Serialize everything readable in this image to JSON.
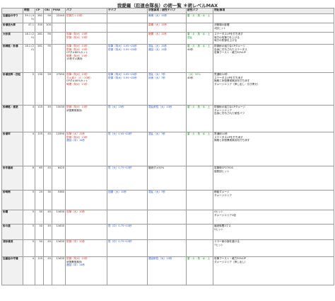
{
  "title": "我愛羅（忍連合隊長）の術一覧 ＊術レベルMAX",
  "headers": [
    "",
    "時間",
    "CP",
    "CRI",
    "POW",
    "バフ",
    "デバフ",
    "状態異常 / 耐性デバフ",
    "耐性バフ",
    "特記事項"
  ],
  "rows": [
    {
      "name": "加重岩の守り",
      "sub": "",
      "time": "39.1 (45)",
      "cp": "281",
      "cri": "90",
      "pow": "22240",
      "buff": [
        {
          "t": "防御力＋10秒",
          "c": "r"
        }
      ],
      "debuff": [],
      "status": [
        {
          "t": "麻痺（大）15秒",
          "c": "b"
        }
      ],
      "resbuff": [
        {
          "t": "雷・炎・風・水・土",
          "c": "g"
        }
      ],
      "notes": [
        {
          "t": "",
          "c": "k"
        }
      ]
    },
    {
      "name": "砂瀑送大葬",
      "sub": "",
      "time": "47.1",
      "cp": "330",
      "cri": "100",
      "pow": "",
      "buff": [],
      "debuff": [],
      "status": [
        {
          "t": "劇毒（大）15秒",
          "c": "r"
        }
      ],
      "resbuff": [],
      "notes": [
        {
          "t": "決戦場の影響",
          "c": "k"
        },
        {
          "t": "2回ヒット",
          "c": "k"
        }
      ]
    },
    {
      "name": "大砂漠",
      "sub": "",
      "time": "18.1 (20)",
      "cp": "281",
      "cri": "95",
      "pow": "",
      "buff": [
        {
          "t": "攻撃（特大）15秒",
          "c": "r"
        },
        {
          "t": "防御（特大）15秒",
          "c": "r"
        }
      ],
      "debuff": [],
      "status": [
        {
          "t": "暗闇（大）15秒",
          "c": "r"
        }
      ],
      "resbuff": [
        {
          "t": "雷・炎・風・水・土",
          "c": "g"
        },
        {
          "t": "混乱",
          "c": "g"
        }
      ],
      "notes": [
        {
          "t": "ステータスUPを打ち消す",
          "c": "k"
        },
        {
          "t": "味方の攻撃力を上げる",
          "c": "k"
        },
        {
          "t": "味方の防御を上げる",
          "c": "k"
        }
      ]
    },
    {
      "name": "砂縛柩・砂瀑",
      "sub": "",
      "time": "18.1 (20)",
      "cp": "281",
      "cri": "95",
      "pow": "",
      "buff": [
        {
          "t": "攻撃（特大）15秒",
          "c": "r"
        },
        {
          "t": "防御（特大）15秒",
          "c": "r"
        },
        {
          "t": "CPダメ80%カット",
          "c": "k"
        },
        {
          "t": "時間（特大）15秒",
          "c": "r"
        },
        {
          "t": "15秒ダメ無効",
          "c": "k"
        }
      ],
      "debuff": [
        {
          "t": "攻撃（特大）0.95→20秒",
          "c": "b"
        },
        {
          "t": "防御（特大）0.95→20秒",
          "c": "b"
        }
      ],
      "status": [
        {
          "t": "混乱（大）15秒",
          "c": "b"
        },
        {
          "t": "遅延（大）15秒",
          "c": "b"
        }
      ],
      "resbuff": [
        {
          "t": "雷・炎・風・水・土",
          "c": "g"
        },
        {
          "t": "40秒",
          "c": "k"
        }
      ],
      "notes": [
        {
          "t": "防御術の強力なCPダメージ",
          "c": "k"
        },
        {
          "t": "自身に付与されたステータス",
          "c": "k"
        },
        {
          "t": "攻撃ブースト・威力30%UP",
          "c": "k"
        }
      ]
    },
    {
      "name": "砂瀑送葬・四柱",
      "sub": "",
      "time": "5",
      "cp": "130",
      "cri": "59",
      "pow": "27550",
      "buff": [
        {
          "t": "攻撃（特大）15秒",
          "c": "r"
        },
        {
          "t": "ダメ減少（小・20秒）",
          "c": "r"
        },
        {
          "t": "CPダメ40%カット",
          "c": "k"
        },
        {
          "t": "時間（特大）15秒",
          "c": "r"
        }
      ],
      "debuff": [
        {
          "t": "攻撃（特大）0.95→20秒",
          "c": "b"
        },
        {
          "t": "防御（特大）0.95→20秒",
          "c": "b"
        }
      ],
      "status": [
        {
          "t": "混乱（大）7秒",
          "c": "b"
        },
        {
          "t": "封術（大）7秒",
          "c": "b"
        }
      ],
      "resbuff": [
        {
          "t": "（大）50%",
          "c": "g"
        },
        {
          "t": "40秒",
          "c": "k"
        }
      ],
      "notes": [
        {
          "t": "貫通術10秒",
          "c": "k"
        },
        {
          "t": "ステータスUPを打ち消す",
          "c": "k"
        },
        {
          "t": "無敵と状態異常無効を打ち消す",
          "c": "k"
        },
        {
          "t": "ダメージエリア（押し出し・引き寄せ）",
          "c": "k"
        }
      ]
    },
    {
      "name": "砂縛柩・連塗",
      "sub": "",
      "time": "4",
      "cp": "110",
      "cri": "45",
      "pow": "15030",
      "buff": [
        {
          "t": "防御（特大）15秒",
          "c": "r"
        },
        {
          "t": "状態異常無効",
          "c": "k"
        }
      ],
      "debuff": [
        {
          "t": "防（大）15秒",
          "c": "b"
        }
      ],
      "status": [
        {
          "t": "混乱耐性（大）15秒",
          "c": "b"
        }
      ],
      "resbuff": [
        {
          "t": "雷・炎・風・水・土",
          "c": "g"
        }
      ],
      "notes": [
        {
          "t": "防御術の強力なCPダメージ",
          "c": "k"
        },
        {
          "t": "ダメージエリア",
          "c": "k"
        },
        {
          "t": "自身に付与された耐性バフ",
          "c": "k"
        }
      ]
    },
    {
      "name": "砂瀑牢",
      "sub": "",
      "time": "4",
      "cp": "110",
      "cri": "45",
      "pow": "13390",
      "buff": [
        {
          "t": "攻撃（大）15秒",
          "c": "r"
        },
        {
          "t": "防御（特大）15秒",
          "c": "r"
        },
        {
          "t": "遅延（中）14秒",
          "c": "b"
        }
      ],
      "debuff": [
        {
          "t": "防（大）0.95→20秒",
          "c": "b"
        }
      ],
      "status": [
        {
          "t": "混乱（大）7秒",
          "c": "b"
        }
      ],
      "resbuff": [
        {
          "t": "雷・炎・風・水・土",
          "c": "g"
        }
      ],
      "notes": [
        {
          "t": "貫通術10秒",
          "c": "k"
        },
        {
          "t": "ステータスUPを打ち消す",
          "c": "k"
        },
        {
          "t": "無敵と状態異常無効を打ち消す",
          "c": "k"
        }
      ]
    },
    {
      "name": "砂手裏剣",
      "sub": "",
      "time": "6",
      "cp": "65",
      "cri": "45",
      "pow": "6420",
      "buff": [],
      "debuff": [
        {
          "t": "防（大）0.75→15秒",
          "c": "b"
        }
      ],
      "status": [
        {
          "t": "継続ダメ50%",
          "c": "k"
        }
      ],
      "resbuff": [],
      "notes": [
        {
          "t": "攻撃時CP27000",
          "c": "k"
        },
        {
          "t": "複数回ヒット",
          "c": "k"
        }
      ]
    },
    {
      "name": "砂時雨",
      "sub": "",
      "time": "5",
      "cp": "20",
      "cri": "30",
      "pow": "5380",
      "buff": [],
      "debuff": [
        {
          "t": "回避（大）15秒",
          "c": "b"
        }
      ],
      "status": [
        {
          "t": "混乱（大）7秒",
          "c": "b"
        }
      ],
      "resbuff": [],
      "notes": [
        {
          "t": "移動ダメージ",
          "c": "k"
        },
        {
          "t": "ダメージエリア",
          "c": "k"
        }
      ]
    },
    {
      "name": "砂霧",
      "sub": "",
      "time": "5",
      "cp": "30",
      "cri": "45",
      "pow": "11630",
      "buff": [
        {
          "t": "攻撃（大）10秒",
          "c": "r"
        }
      ],
      "debuff": [],
      "status": [],
      "resbuff": [],
      "notes": [
        {
          "t": "4ヒット",
          "c": "k"
        },
        {
          "t": "ダメージエリア2倍",
          "c": "k"
        }
      ]
    },
    {
      "name": "砂の盾",
      "sub": "",
      "time": "5",
      "cp": "30",
      "cri": "45",
      "pow": "11630",
      "buff": [],
      "debuff": [
        {
          "t": "防（中）0.75→10秒",
          "c": "b"
        }
      ],
      "status": [],
      "resbuff": [],
      "notes": [
        {
          "t": "継続時間3マス",
          "c": "k"
        },
        {
          "t": "5ヒット",
          "c": "k"
        }
      ]
    },
    {
      "name": "流砂瀑流",
      "sub": "",
      "time": "5",
      "cp": "30",
      "cri": "45",
      "pow": "11630",
      "buff": [
        {
          "t": "防御（中）10秒",
          "c": "r"
        }
      ],
      "debuff": [
        {
          "t": "防（中）0.75→15秒",
          "c": "b"
        }
      ],
      "status": [],
      "resbuff": [],
      "notes": [
        {
          "t": "ミラー術の崩を避ける",
          "c": "k"
        },
        {
          "t": "7ヒット",
          "c": "k"
        }
      ]
    },
    {
      "name": "加重岩の守護",
      "sub": "",
      "time": "4",
      "cp": "110",
      "cri": "45",
      "pow": "11630",
      "buff": [
        {
          "t": "防御（特大）15秒",
          "c": "r"
        },
        {
          "t": "状態異常無効",
          "c": "k"
        },
        {
          "t": "遅延（中）14秒",
          "c": "b"
        }
      ],
      "debuff": [],
      "status": [
        {
          "t": "遅延耐性（大）15秒",
          "c": "b"
        }
      ],
      "resbuff": [
        {
          "t": "雷・炎・風・水・土",
          "c": "g"
        }
      ],
      "notes": [
        {
          "t": "攻撃ブースト・威力30%UP",
          "c": "k"
        },
        {
          "t": "ダメージエリア（押し出し）",
          "c": "k"
        }
      ]
    }
  ]
}
